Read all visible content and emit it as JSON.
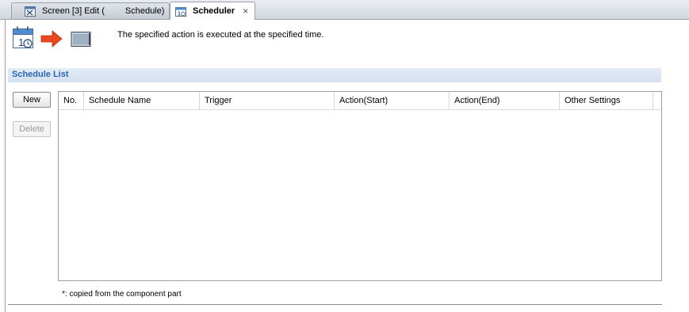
{
  "tabs": {
    "inactive": {
      "part1": "Screen [3] Edit (",
      "part2": "Schedule)"
    },
    "active": {
      "label": "Scheduler",
      "close": "×"
    }
  },
  "header": {
    "description": "The specified action is executed at the specified time."
  },
  "section": {
    "title": "Schedule List"
  },
  "buttons": {
    "new": "New",
    "delete": "Delete"
  },
  "table": {
    "columns": [
      "No.",
      "Schedule Name",
      "Trigger",
      "Action(Start)",
      "Action(End)",
      "Other Settings"
    ],
    "rows": []
  },
  "note": "*: copied from the component part",
  "colors": {
    "section_title": "#2b63b5",
    "section_bar": "#dce6f2",
    "arrow": "#e8491e"
  },
  "icons": [
    "calendar-icon",
    "arrow-right-icon",
    "monitor-icon",
    "screen-edit-icon",
    "scheduler-icon",
    "close-icon"
  ]
}
